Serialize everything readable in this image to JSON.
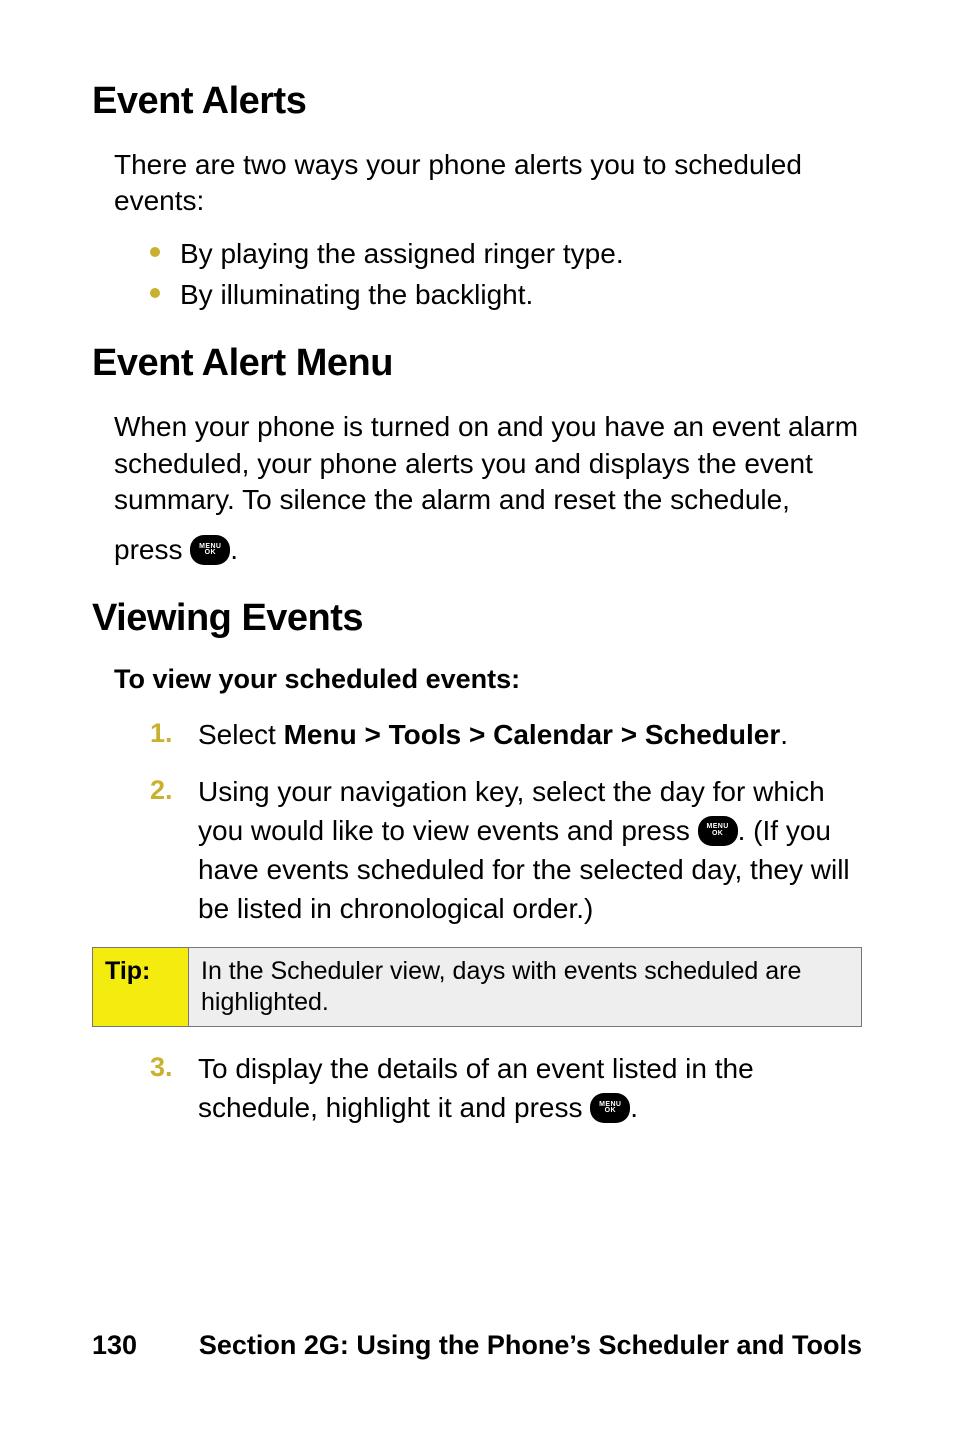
{
  "sections": {
    "event_alerts": {
      "title": "Event Alerts",
      "lead": "There are two ways your phone alerts you to scheduled events:",
      "bullets": [
        "By playing the assigned ringer type.",
        "By illuminating the backlight."
      ]
    },
    "event_alert_menu": {
      "title": "Event Alert Menu",
      "para_a": "When your phone is turned on and you have an event alarm scheduled, your phone alerts you and displays the event summary. To silence the alarm and reset the schedule,",
      "para_b_pre": "press ",
      "para_b_post": "."
    },
    "viewing_events": {
      "title": "Viewing Events",
      "sub": "To view your scheduled events:",
      "step1_pre": "Select ",
      "step1_bold": "Menu > Tools > Calendar > Scheduler",
      "step1_post": ".",
      "step2_pre": "Using your navigation key, select the day for which you would like to view events and press  ",
      "step2_post": ". (If you have events scheduled for the selected day, they will be listed in chronological order.)",
      "step3_pre": "To display the details of an event listed in the schedule, highlight it and press  ",
      "step3_post": "."
    },
    "tip": {
      "label": "Tip:",
      "text": "In the Scheduler view, days with events scheduled are highlighted."
    }
  },
  "icon": {
    "line1": "MENU",
    "line2": "OK"
  },
  "footer": {
    "page": "130",
    "section": "Section 2G: Using the Phone’s Scheduler and Tools"
  }
}
